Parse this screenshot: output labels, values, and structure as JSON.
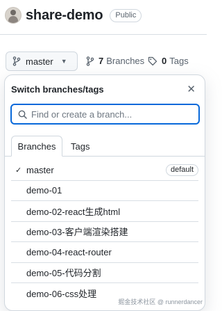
{
  "repo": {
    "name": "share-demo",
    "visibility": "Public"
  },
  "toolbar": {
    "current_branch": "master",
    "branches_count": "7",
    "branches_label": "Branches",
    "tags_count": "0",
    "tags_label": "Tags"
  },
  "dropdown": {
    "title": "Switch branches/tags",
    "search_placeholder": "Find or create a branch...",
    "tabs": [
      {
        "label": "Branches",
        "active": true
      },
      {
        "label": "Tags",
        "active": false
      }
    ],
    "branches": [
      {
        "name": "master",
        "selected": true,
        "badge": "default"
      },
      {
        "name": "demo-01"
      },
      {
        "name": "demo-02-react生成html"
      },
      {
        "name": "demo-03-客户端渲染搭建"
      },
      {
        "name": "demo-04-react-router"
      },
      {
        "name": "demo-05-代码分割"
      },
      {
        "name": "demo-06-css处理"
      }
    ]
  },
  "watermark": "掘金技术社区 @ runnerdancer",
  "icons": {
    "branch": "git-branch-icon",
    "tag": "tag-icon",
    "search": "search-icon",
    "close": "close-icon",
    "check": "check-icon"
  },
  "colors": {
    "accent": "#0969da",
    "border": "#d0d7de",
    "text": "#1f2328",
    "muted": "#59636e"
  }
}
